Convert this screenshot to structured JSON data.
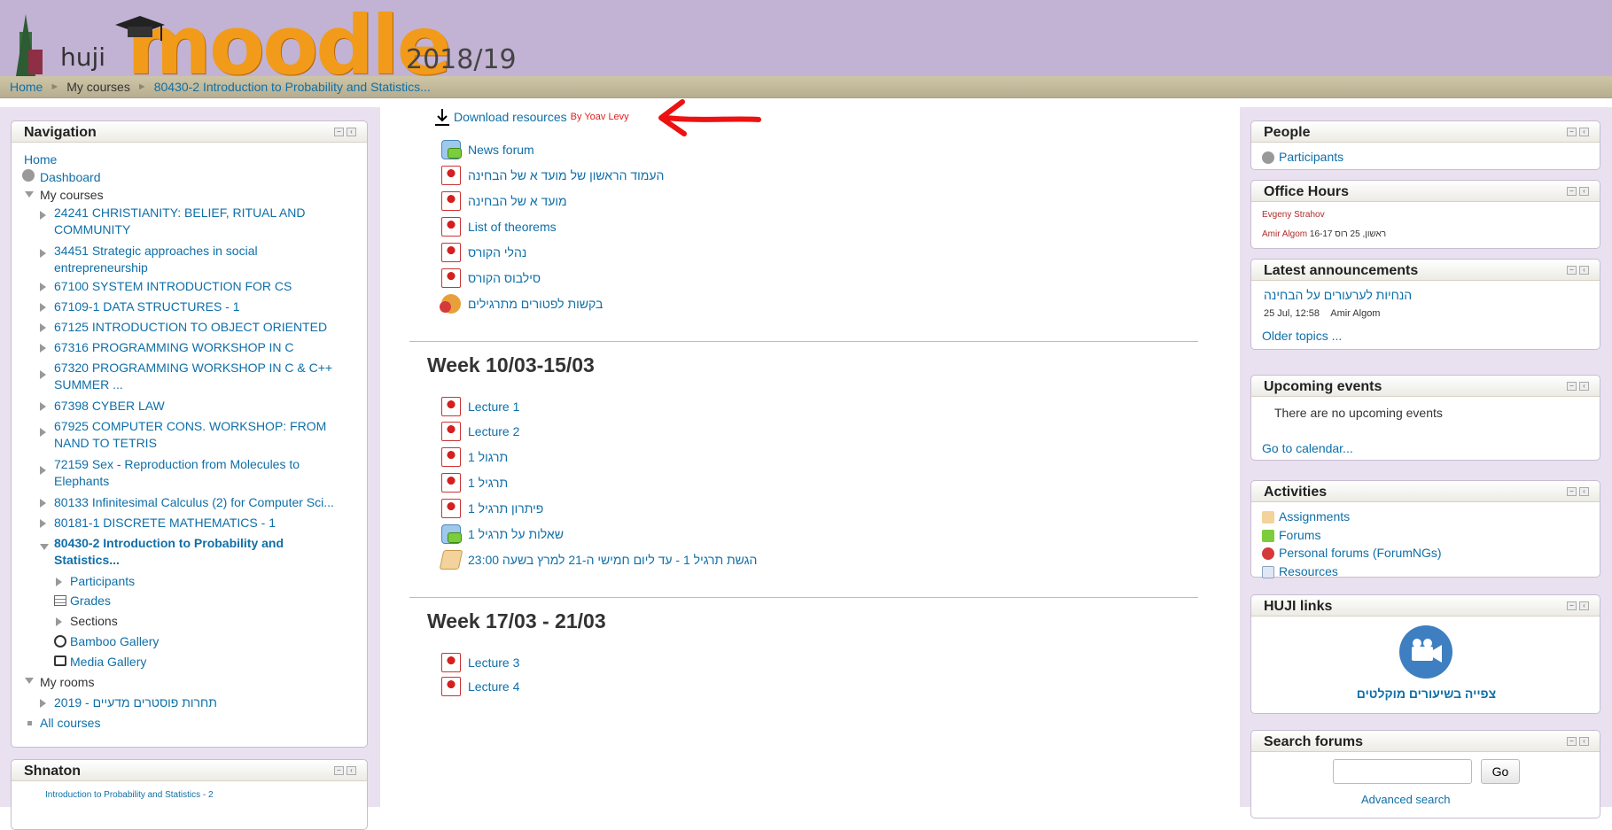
{
  "header": {
    "huji": "huji",
    "moodle": "moodle",
    "year": "2018/19"
  },
  "breadcrumb": {
    "home": "Home",
    "my_courses": "My courses",
    "course": "80430-2 Introduction to Probability and Statistics..."
  },
  "nav": {
    "title": "Navigation",
    "home": "Home",
    "dashboard": "Dashboard",
    "my_courses": "My courses",
    "courses": [
      "24241 CHRISTIANITY: BELIEF, RITUAL AND",
      "COMMUNITY",
      "34451 Strategic approaches in social",
      "entrepreneurship",
      "67100 SYSTEM INTRODUCTION FOR CS",
      "67109-1 DATA STRUCTURES - 1",
      "67125 INTRODUCTION TO OBJECT ORIENTED",
      "67316 PROGRAMMING WORKSHOP IN C",
      "67320 PROGRAMMING WORKSHOP IN C & C++",
      "SUMMER ...",
      "67398 CYBER LAW",
      "67925 COMPUTER CONS. WORKSHOP: FROM",
      "NAND TO TETRIS",
      "72159 Sex - Reproduction from Molecules to",
      "Elephants",
      "80133 Infinitesimal Calculus (2) for Computer Sci...",
      "80181-1 DISCRETE MATHEMATICS - 1",
      "80430-2 Introduction to Probability and",
      "Statistics..."
    ],
    "participants": "Participants",
    "grades": "Grades",
    "sections": "Sections",
    "bamboo": "Bamboo Gallery",
    "media": "Media Gallery",
    "my_rooms": "My rooms",
    "room_item": "2019 - תחרות פוסטרים מדעיים",
    "all_courses": "All courses"
  },
  "shnaton": {
    "title": "Shnaton",
    "item": "Introduction to Probability and Statistics - 2"
  },
  "center": {
    "download": "Download resources",
    "by": "By Yoav Levy",
    "top_items": [
      "News forum",
      "העמוד הראשון של מועד א של הבחינה",
      "מועד א של הבחינה",
      "List of theorems",
      "נהלי הקורס",
      "סילבוס הקורס",
      "בקשות לפטורים מתרגילים"
    ],
    "week1_title": "Week 10/03-15/03",
    "week1_items": [
      "Lecture 1",
      "Lecture 2",
      "תרגול 1",
      "תרגיל 1",
      "פיתרון תרגיל 1",
      "שאלות על תרגיל 1",
      "הגשת תרגיל 1 - עד ליום חמישי ה-21 למרץ בשעה 23:00"
    ],
    "week2_title": "Week 17/03 - 21/03",
    "week2_items": [
      "Lecture 3",
      "Lecture 4"
    ]
  },
  "right": {
    "people_title": "People",
    "participants": "Participants",
    "office_title": "Office Hours",
    "office_1": "Evgeny Strahov",
    "office_2_name": "Amir Algom",
    "office_2_info": "16-17 ראשון, 25 רוס",
    "ann_title": "Latest announcements",
    "ann_link": "הנחיות לערעורים על הבחינה",
    "ann_date": "25 Jul, 12:58",
    "ann_author": "Amir Algom",
    "ann_older": "Older topics ...",
    "events_title": "Upcoming events",
    "events_none": "There are no upcoming events",
    "events_cal": "Go to calendar...",
    "act_title": "Activities",
    "act_items": [
      "Assignments",
      "Forums",
      "Personal forums (ForumNGs)",
      "Resources"
    ],
    "huji_title": "HUJI links",
    "huji_link": "צפייה בשיעורים מוקלטים",
    "search_title": "Search forums",
    "search_go": "Go",
    "search_adv": "Advanced search"
  }
}
